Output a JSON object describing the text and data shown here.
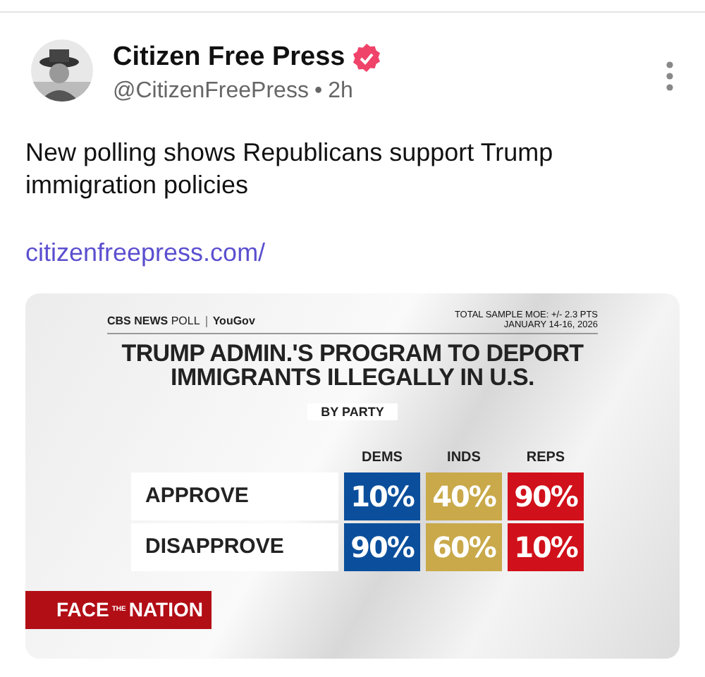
{
  "post": {
    "author": "Citizen Free Press",
    "verified": true,
    "handle": "@CitizenFreePress",
    "separator": "•",
    "time": "2h",
    "text": "New polling shows Republicans support Trump immigration policies",
    "link": "citizenfreepress.com/"
  },
  "graphic": {
    "source": "CBS NEWS",
    "source_suffix": "POLL",
    "partner": "YouGov",
    "meta": [
      "TOTAL SAMPLE MOE: +/- 2.3 PTS",
      "JANUARY 14-16, 2026"
    ],
    "title": "TRUMP ADMIN.'S PROGRAM TO DEPORT IMMIGRANTS ILLEGALLY IN U.S.",
    "subtitle": "BY PARTY",
    "columns": [
      {
        "label": "DEMS",
        "color": "#0b4f9c"
      },
      {
        "label": "INDS",
        "color": "#c9a94a"
      },
      {
        "label": "REPS",
        "color": "#d0101a"
      }
    ],
    "rows": [
      {
        "label": "APPROVE",
        "values": [
          "10%",
          "40%",
          "90%"
        ]
      },
      {
        "label": "DISAPPROVE",
        "values": [
          "90%",
          "60%",
          "10%"
        ]
      }
    ],
    "show_logo": [
      "FACE",
      "THE",
      "NATION"
    ]
  }
}
